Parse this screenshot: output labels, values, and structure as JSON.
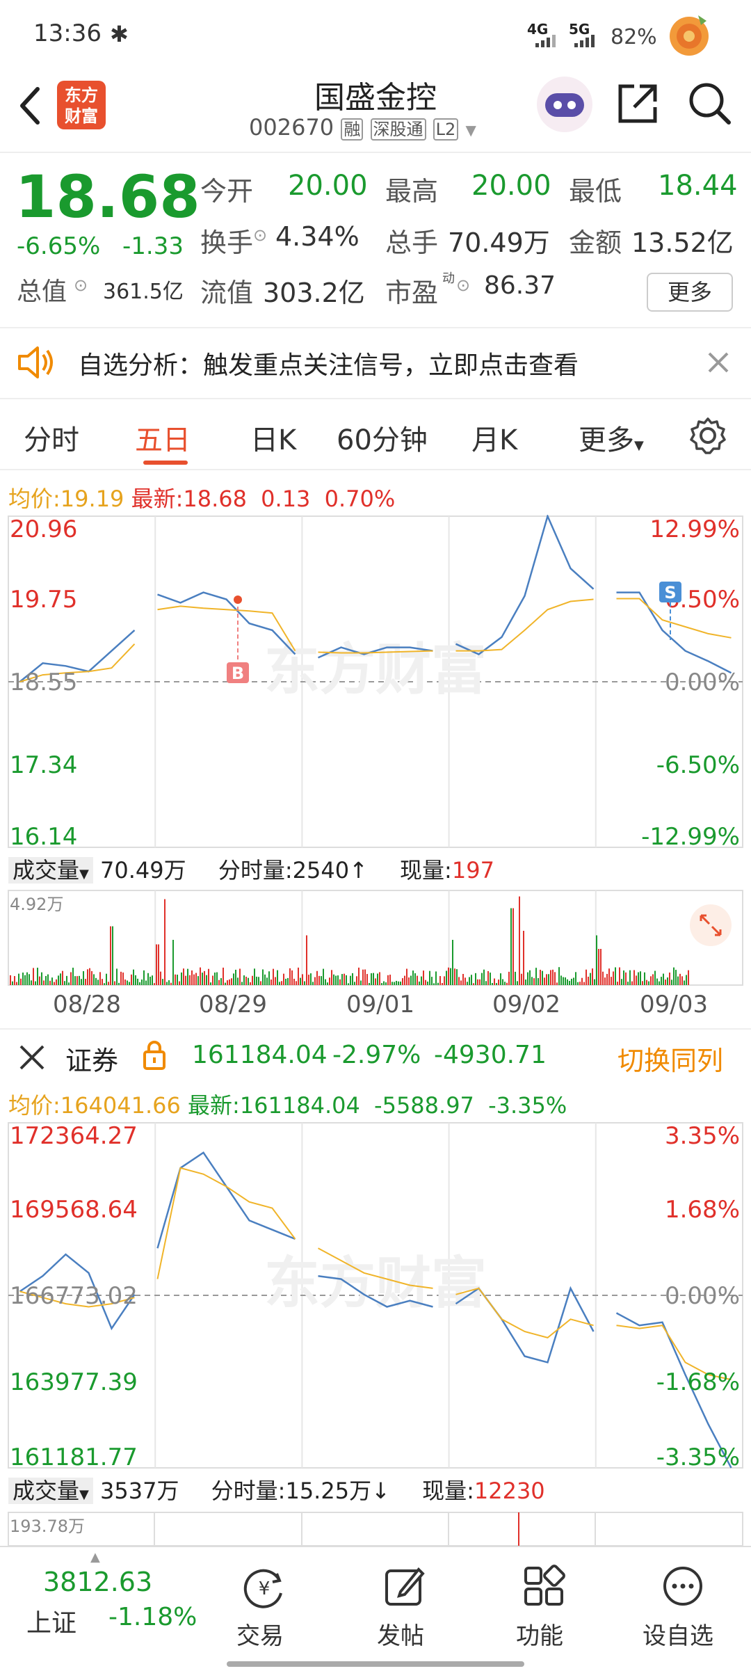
{
  "status_bar": {
    "time": "13:36",
    "net1": "4G",
    "net2": "5G",
    "battery": "82%"
  },
  "header": {
    "title": "国盛金控",
    "code": "002670",
    "tag1": "融",
    "tag2": "深股通",
    "tag3": "L2",
    "logo_line1": "东方",
    "logo_line2": "财富"
  },
  "quote": {
    "price": "18.68",
    "change_pct": "-6.65%",
    "change": "-1.33",
    "open_label": "今开",
    "open": "20.00",
    "high_label": "最高",
    "high": "20.00",
    "low_label": "最低",
    "low": "18.44",
    "turnover_label": "换手",
    "turnover": "4.34%",
    "volume_label": "总手",
    "volume": "70.49万",
    "amount_label": "金额",
    "amount": "13.52亿",
    "mcap_label": "总值",
    "mcap": "361.5亿",
    "float_label": "流值",
    "float": "303.2亿",
    "pe_label": "市盈",
    "pe_sup": "动",
    "pe": "86.37",
    "more": "更多"
  },
  "notice": {
    "text": "自选分析：触发重点关注信号，立即点击查看"
  },
  "tabs": {
    "items": [
      "分时",
      "五日",
      "日K",
      "60分钟",
      "月K",
      "更多"
    ],
    "active": "五日"
  },
  "chart1": {
    "avg_label": "均价:",
    "avg": "19.19",
    "latest_label": "最新:",
    "latest": "18.68",
    "delta": "0.13",
    "delta_pct": "0.70%",
    "y_left": [
      "20.96",
      "19.75",
      "18.55",
      "17.34",
      "16.14"
    ],
    "y_right": [
      "12.99%",
      "6.50%",
      "0.00%",
      "-6.50%",
      "-12.99%"
    ],
    "watermark": "东方财富",
    "marker_b": "B",
    "marker_s": "S",
    "vol_label": "成交量",
    "vol_total": "70.49万",
    "minvol_label": "分时量:",
    "minvol": "2540",
    "minvol_arrow": "↑",
    "cur_label": "现量:",
    "cur": "197",
    "vol_max": "4.92万",
    "dates": [
      "08/28",
      "08/29",
      "09/01",
      "09/02",
      "09/03"
    ]
  },
  "sector": {
    "name": "证券",
    "value": "161184.04",
    "pct": "-2.97%",
    "change": "-4930.71",
    "switch": "切换同列"
  },
  "chart2": {
    "avg_label": "均价:",
    "avg": "164041.66",
    "latest_label": "最新:",
    "latest": "161184.04",
    "delta": "-5588.97",
    "delta_pct": "-3.35%",
    "y_left": [
      "172364.27",
      "169568.64",
      "166773.02",
      "163977.39",
      "161181.77"
    ],
    "y_right": [
      "3.35%",
      "1.68%",
      "0.00%",
      "-1.68%",
      "-3.35%"
    ],
    "vol_label": "成交量",
    "vol_total": "3537万",
    "minvol_label": "分时量:",
    "minvol": "15.25万",
    "minvol_arrow": "↓",
    "cur_label": "现量:",
    "cur": "12230",
    "vol_max": "193.78万"
  },
  "bottom": {
    "index_value": "3812.63",
    "index_name": "上证",
    "index_pct": "-1.18%",
    "items": [
      "交易",
      "发帖",
      "功能",
      "设自选"
    ]
  },
  "chart_data": [
    {
      "type": "line",
      "title": "",
      "x_categories": [
        "08/28",
        "08/29",
        "09/01",
        "09/02",
        "09/03"
      ],
      "ylim": [
        16.14,
        20.96
      ],
      "series": [
        {
          "name": "最新",
          "values": [
            18.55,
            18.82,
            18.78,
            18.7,
            19.0,
            19.3,
            19.82,
            19.7,
            19.85,
            19.75,
            19.4,
            19.3,
            18.95,
            18.9,
            19.05,
            18.95,
            19.05,
            19.05,
            19.0,
            19.1,
            18.95,
            19.2,
            19.8,
            20.96,
            20.2,
            19.9,
            19.85,
            19.85,
            19.3,
            19.0,
            18.85,
            18.68
          ]
        },
        {
          "name": "均价",
          "values": [
            18.55,
            18.65,
            18.68,
            18.7,
            18.75,
            19.1,
            19.6,
            19.65,
            19.62,
            19.6,
            19.58,
            19.55,
            19.0,
            18.98,
            18.97,
            18.97,
            18.98,
            18.99,
            19.0,
            19.0,
            19.0,
            19.02,
            19.3,
            19.6,
            19.72,
            19.75,
            19.76,
            19.76,
            19.45,
            19.35,
            19.25,
            19.19
          ]
        }
      ]
    },
    {
      "type": "line",
      "title": "证券",
      "x_categories": [
        "08/28",
        "08/29",
        "09/01",
        "09/02",
        "09/03"
      ],
      "ylim": [
        161181.77,
        172364.27
      ],
      "series": [
        {
          "name": "最新",
          "values": [
            166900,
            167400,
            168100,
            167500,
            165700,
            166800,
            168300,
            170900,
            171400,
            170300,
            169200,
            168900,
            168600,
            167400,
            167300,
            166800,
            166400,
            166600,
            166400,
            166500,
            167000,
            166000,
            164800,
            164600,
            167000,
            165600,
            166200,
            165800,
            165900,
            164200,
            162600,
            161184
          ]
        },
        {
          "name": "均价",
          "values": [
            166900,
            166700,
            166500,
            166400,
            166500,
            166700,
            167300,
            170900,
            170700,
            170300,
            169800,
            169600,
            168600,
            168300,
            167900,
            167500,
            167300,
            167100,
            167000,
            166800,
            167000,
            166000,
            165600,
            165400,
            166000,
            165800,
            165800,
            165700,
            165800,
            164600,
            164200,
            164042
          ]
        }
      ]
    }
  ]
}
